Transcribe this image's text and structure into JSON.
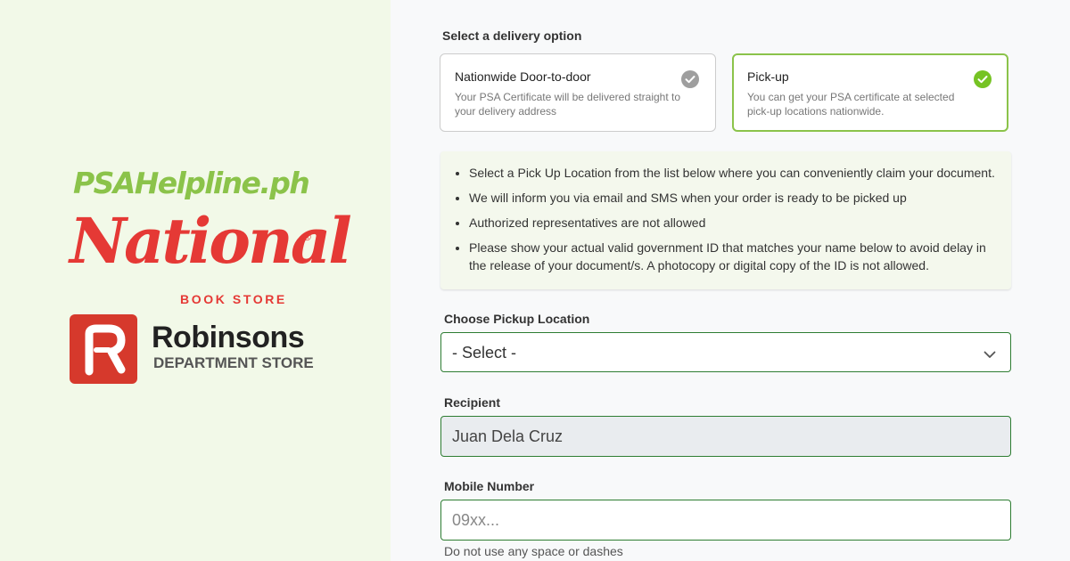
{
  "brand": {
    "site_name": "PSAHelpline.ph",
    "partner1_name": "National",
    "partner1_sub": "BOOK STORE",
    "partner1_reg": "®",
    "partner2_name": "Robinsons",
    "partner2_sub": "DEPARTMENT STORE",
    "colors": {
      "psa_green": "#8bc34a",
      "nbs_red": "#e53935",
      "robinsons_red": "#d6392c"
    }
  },
  "delivery": {
    "label": "Select a delivery option",
    "options": [
      {
        "title": "Nationwide Door-to-door",
        "desc": "Your PSA Certificate will be delivered straight to your delivery address",
        "selected": false,
        "icon": "check-circle-icon",
        "check_color": "#9e9e9e"
      },
      {
        "title": "Pick-up",
        "desc": "You can get your PSA certificate at selected pick-up locations nationwide.",
        "selected": true,
        "icon": "check-circle-icon",
        "check_color": "#76c324"
      }
    ]
  },
  "info": {
    "items": [
      "Select a Pick Up Location from the list below where you can conveniently claim your document.",
      "We will inform you via email and SMS when your order is ready to be picked up",
      "Authorized representatives are not allowed",
      "Please show your actual valid government ID that matches your name below to avoid delay in the release of your document/s. A photocopy or digital copy of the ID is not allowed."
    ]
  },
  "pickup": {
    "label": "Choose Pickup Location",
    "selected_value": "- Select -",
    "icon": "chevron-down-icon"
  },
  "recipient": {
    "label": "Recipient",
    "value": "Juan Dela Cruz"
  },
  "mobile": {
    "label": "Mobile Number",
    "placeholder": "09xx...",
    "hint": "Do not use any space or dashes"
  }
}
